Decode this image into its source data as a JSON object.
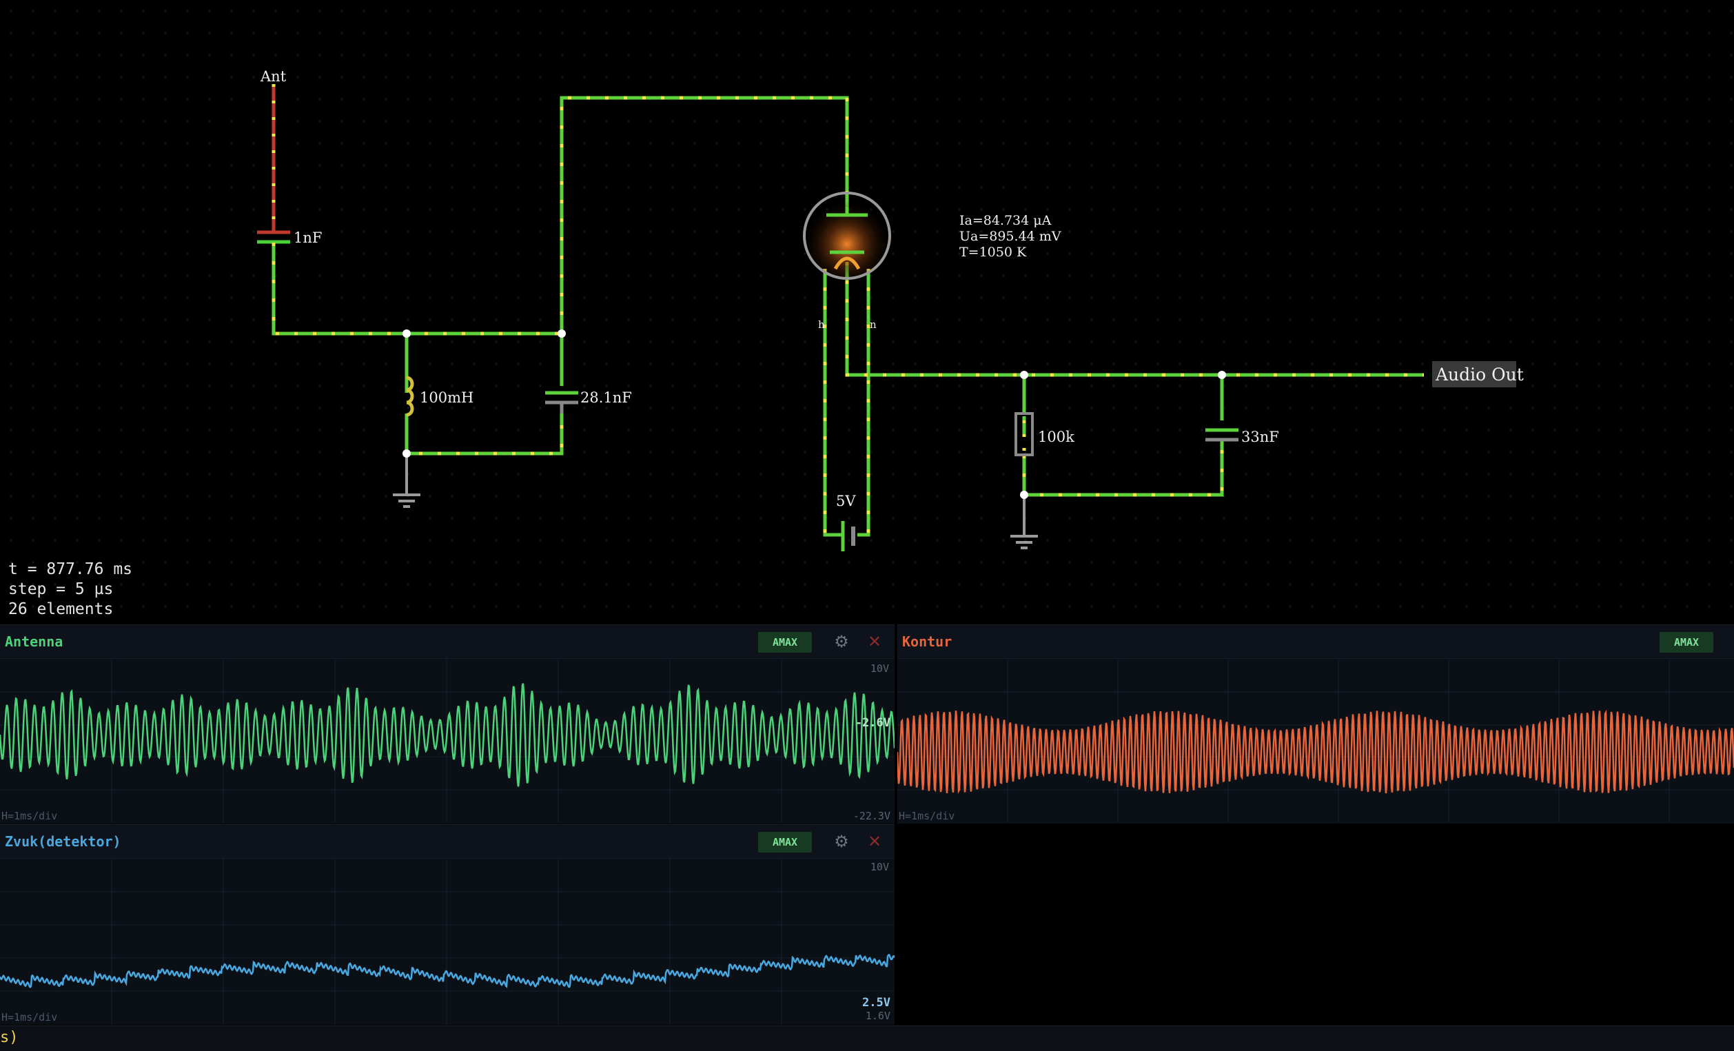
{
  "circuit": {
    "labels": {
      "antenna": "Ant",
      "cap_antenna": "1nF",
      "inductor": "100mH",
      "cap_tank": "28.1nF",
      "tube_readout_ia": "Ia=84.734 μA",
      "tube_readout_ua": "Ua=895.44 mV",
      "tube_readout_t": "T=1050 K",
      "tube_pin_left": "h",
      "tube_pin_right": "n",
      "battery": "5V",
      "resistor": "100k",
      "cap_out": "33nF",
      "output": "Audio Out"
    }
  },
  "status": {
    "time": "t = 877.76 ms",
    "step": "step = 5 µs",
    "elements": "26 elements"
  },
  "scopes": [
    {
      "title": "Antenna",
      "color": "#4cd37a",
      "amax": "AMAX",
      "top_value": "10V",
      "mid_value": "-2.6V",
      "bottom_value": "-22.3V",
      "hdiv": "H=1ms/div"
    },
    {
      "title": "Kontur",
      "color": "#e8643a",
      "amax": "AMAX",
      "hdiv": "H=1ms/div"
    },
    {
      "title": "Zvuk(detektor)",
      "color": "#49a8e0",
      "amax": "AMAX",
      "top_value": "10V",
      "mid_value": "2.5V",
      "bottom_value": "1.6V",
      "hdiv": "H=1ms/div"
    }
  ],
  "bottombar": {
    "text": "s)"
  },
  "icons": {
    "settings": "gear-icon",
    "close": "close-icon"
  }
}
